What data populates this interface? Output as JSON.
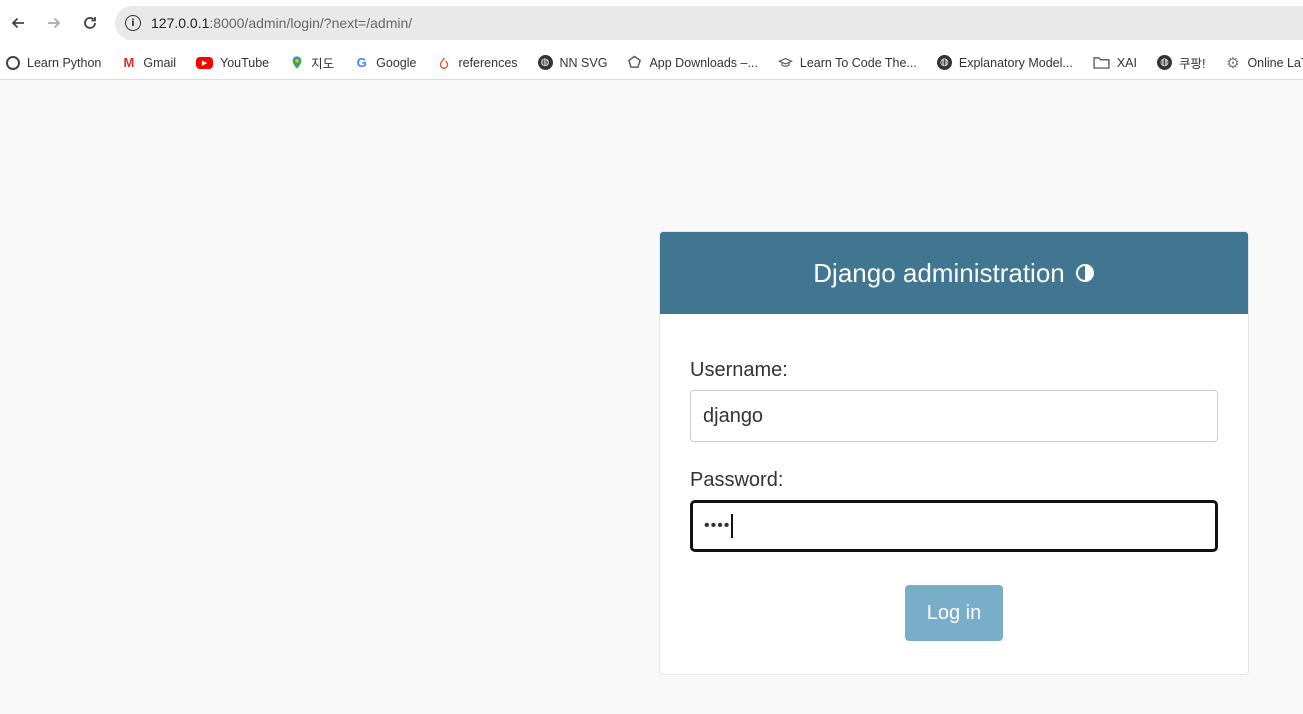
{
  "browser": {
    "url_host": "127.0.0.1",
    "url_rest": ":8000/admin/login/?next=/admin/"
  },
  "bookmarks": [
    {
      "label": "Learn Python",
      "icon": "python-logo-icon"
    },
    {
      "label": "Gmail",
      "icon": "gmail-icon"
    },
    {
      "label": "YouTube",
      "icon": "youtube-icon"
    },
    {
      "label": "지도",
      "icon": "maps-pin-icon"
    },
    {
      "label": "Google",
      "icon": "google-icon"
    },
    {
      "label": "references",
      "icon": "flame-icon"
    },
    {
      "label": "NN SVG",
      "icon": "globe-icon"
    },
    {
      "label": "App Downloads –...",
      "icon": "pentagon-icon"
    },
    {
      "label": "Learn To Code The...",
      "icon": "graduation-cap-icon"
    },
    {
      "label": "Explanatory Model...",
      "icon": "globe-icon"
    },
    {
      "label": "XAI",
      "icon": "folder-icon"
    },
    {
      "label": "쿠팡!",
      "icon": "globe-icon"
    },
    {
      "label": "Online LaTeX",
      "icon": "gear-icon"
    }
  ],
  "login": {
    "title": "Django administration",
    "username_label": "Username:",
    "username_value": "django",
    "password_label": "Password:",
    "password_value": "••••",
    "submit_label": "Log in"
  },
  "colors": {
    "header_bg": "#417690",
    "button_bg": "#79aec8",
    "page_bg": "#f8f8f8"
  }
}
